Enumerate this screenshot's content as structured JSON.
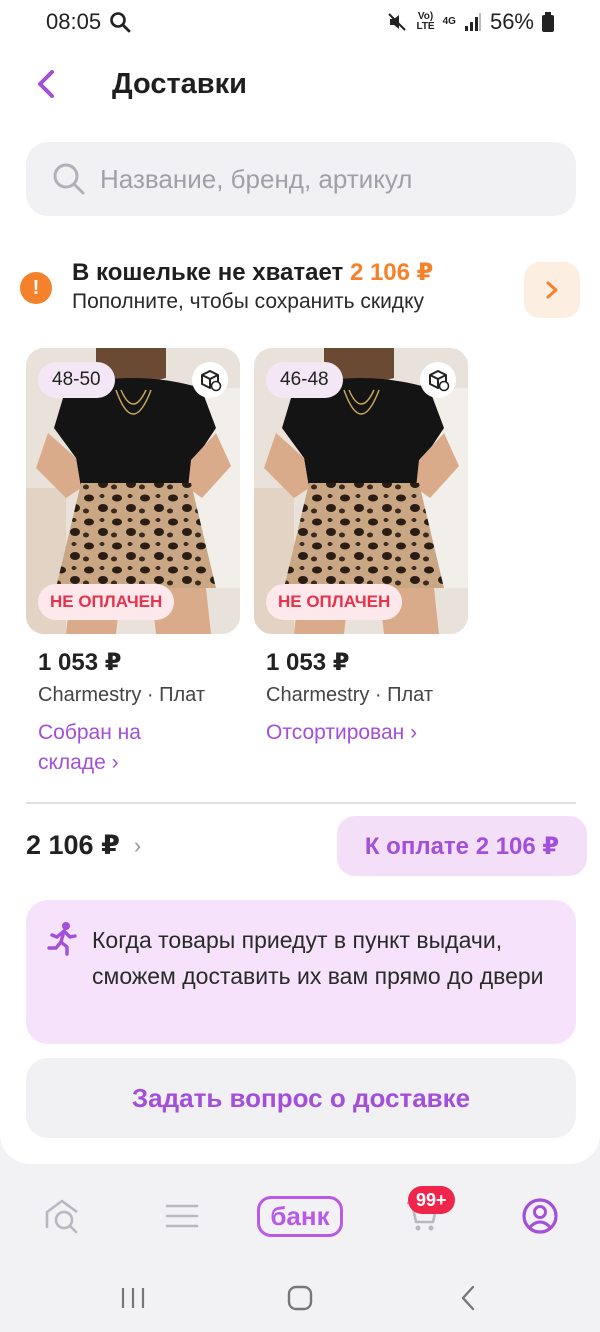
{
  "status_bar": {
    "time": "08:05",
    "network": "4G",
    "battery": "56%"
  },
  "header": {
    "title": "Доставки"
  },
  "search": {
    "placeholder": "Название, бренд, артикул"
  },
  "wallet_notice": {
    "title_prefix": "В кошельке не хватает",
    "amount": "2 106 ₽",
    "subtitle": "Пополните, чтобы сохранить скидку"
  },
  "products": [
    {
      "size": "48-50",
      "payment_status": "НЕ ОПЛАЧЕН",
      "price": "1 053 ₽",
      "brand": "Charmestry · Плат",
      "status_line1": "Собран на",
      "status_line2": "складе ›"
    },
    {
      "size": "46-48",
      "payment_status": "НЕ ОПЛАЧЕН",
      "price": "1 053 ₽",
      "brand": "Charmestry · Плат",
      "status_line1": "Отсортирован ›",
      "status_line2": ""
    }
  ],
  "summary": {
    "total": "2 106 ₽",
    "pay_button": "К оплате 2 106 ₽"
  },
  "info_box": {
    "text": "Когда товары приедут в пункт выдачи, сможем доставить их вам прямо до двери"
  },
  "ask_button": "Задать вопрос о доставке",
  "tabbar": {
    "bank_label": "банк",
    "cart_badge": "99+"
  },
  "colors": {
    "accent": "#a24fd9",
    "warning": "#f5812a",
    "danger": "#e6324b"
  }
}
